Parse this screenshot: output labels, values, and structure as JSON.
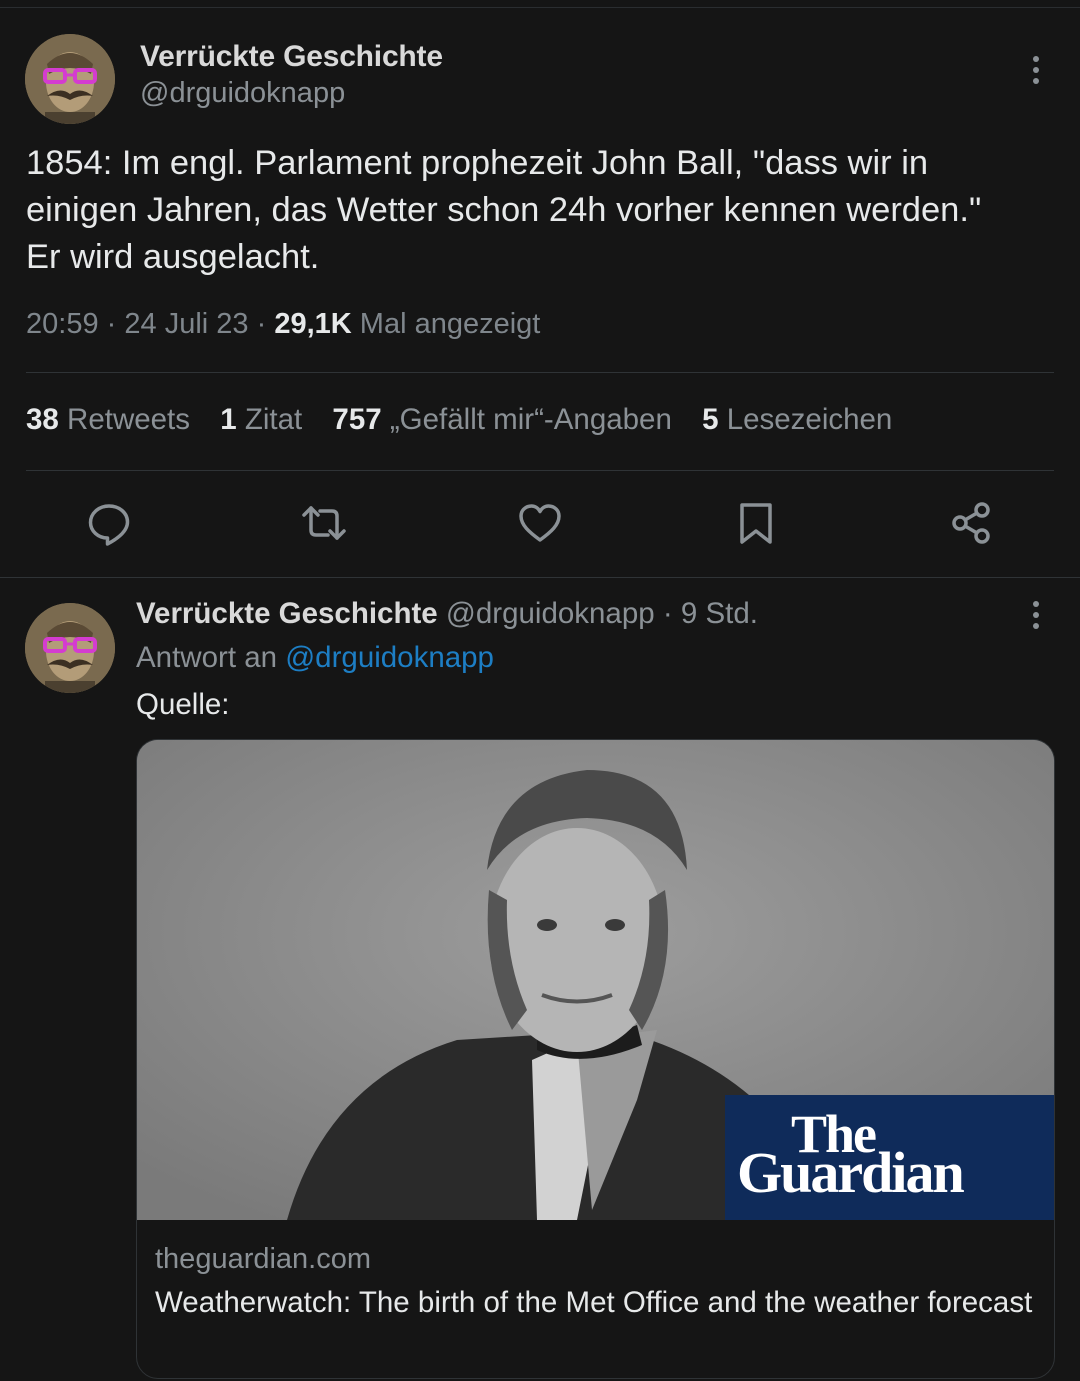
{
  "main_tweet": {
    "author_name": "Verrückte Geschichte",
    "author_handle": "@drguidoknapp",
    "text": "1854: Im engl. Parlament prophezeit John Ball, \"dass wir in\neinigen Jahren, das Wetter schon 24h vorher kennen werden.\"\nEr wird ausgelacht.",
    "time": "20:59",
    "date": "24 Juli 23",
    "views_count": "29,1K",
    "views_label": "Mal angezeigt",
    "separator": "·"
  },
  "stats": {
    "retweets_count": "38",
    "retweets_label": "Retweets",
    "quotes_count": "1",
    "quotes_label": "Zitat",
    "likes_count": "757",
    "likes_label": "„Gefällt mir“-Angaben",
    "bookmarks_count": "5",
    "bookmarks_label": "Lesezeichen"
  },
  "actions": [
    {
      "icon": "reply-icon"
    },
    {
      "icon": "retweet-icon"
    },
    {
      "icon": "heart-icon"
    },
    {
      "icon": "bookmark-icon"
    },
    {
      "icon": "share-icon"
    }
  ],
  "reply_tweet": {
    "author_name": "Verrückte Geschichte",
    "author_handle": "@drguidoknapp",
    "time_ago": "9 Std.",
    "reply_to_label": "Antwort an",
    "reply_to_handle": "@drguidoknapp",
    "text": "Quelle:",
    "card": {
      "logo_line1": "The",
      "logo_line2": "Guardian",
      "domain": "theguardian.com",
      "title": "Weatherwatch: The birth of the Met Office and the weather forecast"
    }
  },
  "colors": {
    "background": "#151515",
    "mention": "#1d7ec4",
    "guardian_blue": "#0f2b5a"
  }
}
